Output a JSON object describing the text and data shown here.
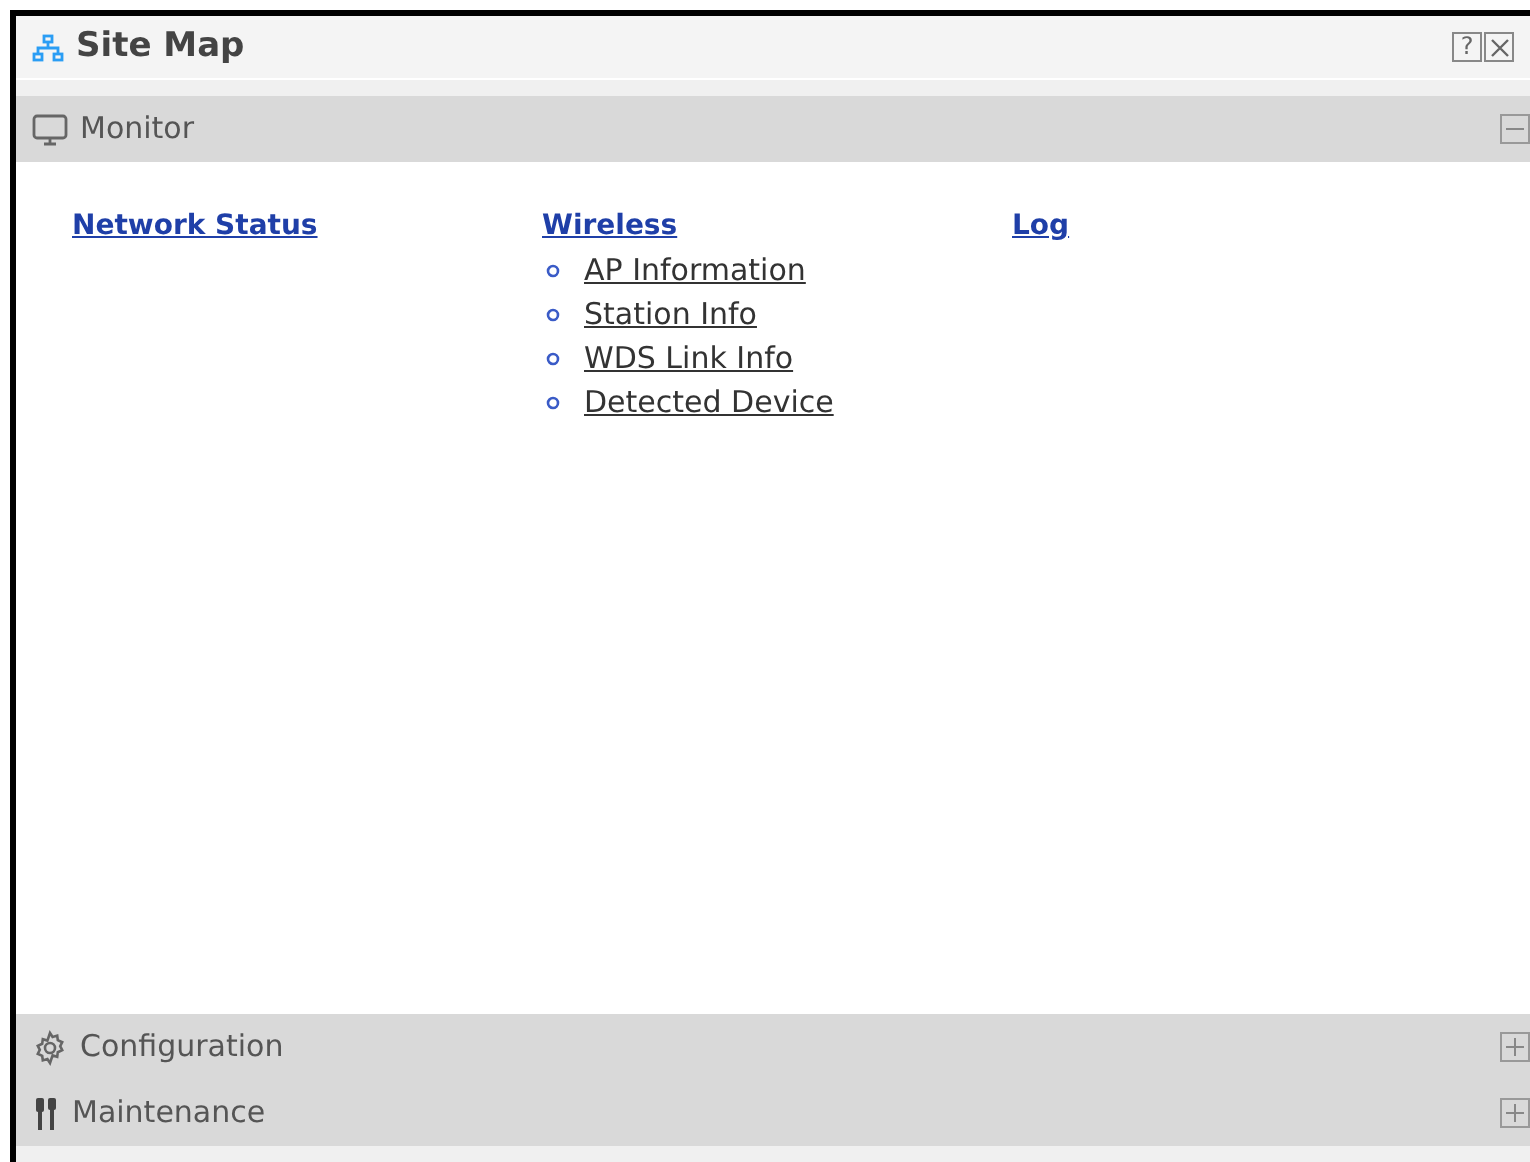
{
  "window": {
    "title": "Site Map",
    "help_button": "?"
  },
  "sections": [
    {
      "kind": "monitor",
      "label": "Monitor",
      "expanded": true,
      "columns": [
        {
          "title": "Network Status"
        },
        {
          "title": "Wireless",
          "children": [
            "AP Information",
            "Station Info",
            "WDS Link Info",
            "Detected Device"
          ]
        },
        {
          "title": "Log"
        }
      ]
    },
    {
      "kind": "configuration",
      "label": "Configuration",
      "expanded": false
    },
    {
      "kind": "maintenance",
      "label": "Maintenance",
      "expanded": false
    }
  ]
}
